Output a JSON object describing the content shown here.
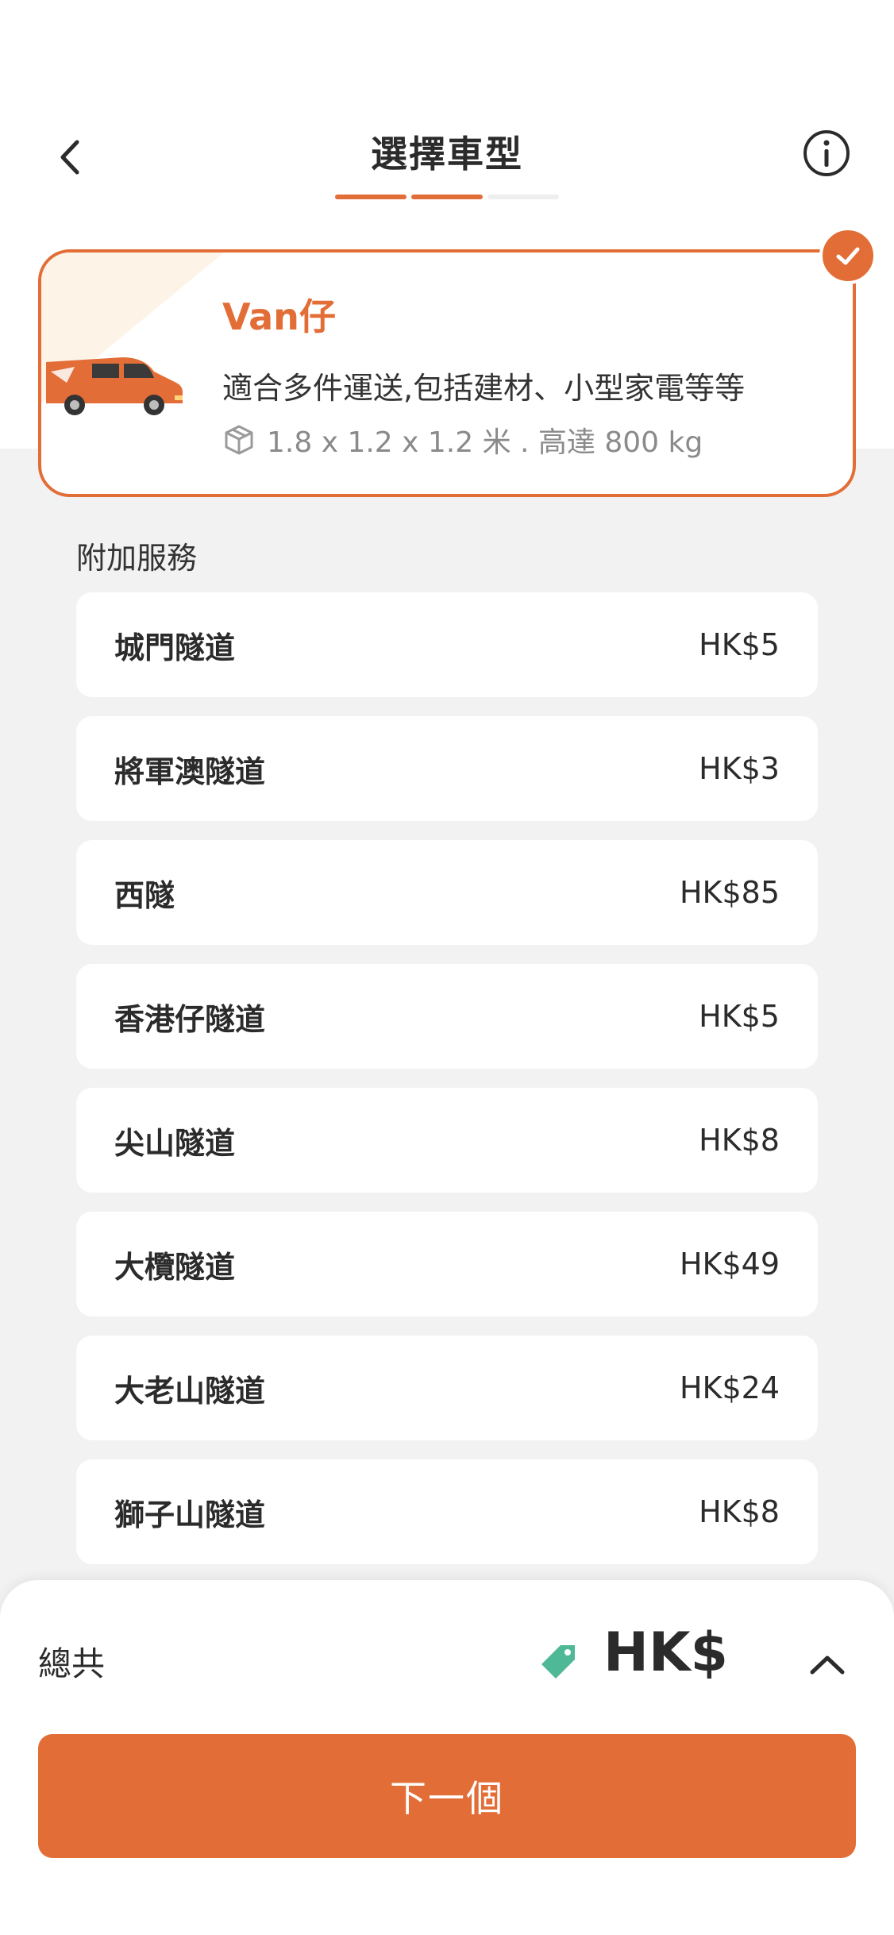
{
  "header": {
    "title": "選擇車型",
    "back_icon": "chevron-left-icon",
    "info_icon": "info-icon",
    "progress_steps_total": 3,
    "progress_steps_active": 2
  },
  "vehicle": {
    "name": "Van仔",
    "description": "適合多件運送,包括建材、小型家電等等",
    "specs": "1.8 x 1.2 x 1.2 米 . 高達 800 kg",
    "selected": true
  },
  "services": {
    "label": "附加服務",
    "items": [
      {
        "name": "城門隧道",
        "price": "HK$5"
      },
      {
        "name": "將軍澳隧道",
        "price": "HK$3"
      },
      {
        "name": "西隧",
        "price": "HK$85"
      },
      {
        "name": "香港仔隧道",
        "price": "HK$5"
      },
      {
        "name": "尖山隧道",
        "price": "HK$8"
      },
      {
        "name": "大欖隧道",
        "price": "HK$49"
      },
      {
        "name": "大老山隧道",
        "price": "HK$24"
      },
      {
        "name": "獅子山隧道",
        "price": "HK$8"
      }
    ]
  },
  "footer": {
    "total_label": "總共",
    "total_amount": "HK$",
    "next_label": "下一個"
  },
  "colors": {
    "accent": "#e36d36",
    "tag": "#4fb896",
    "background": "#f2f2f2"
  }
}
